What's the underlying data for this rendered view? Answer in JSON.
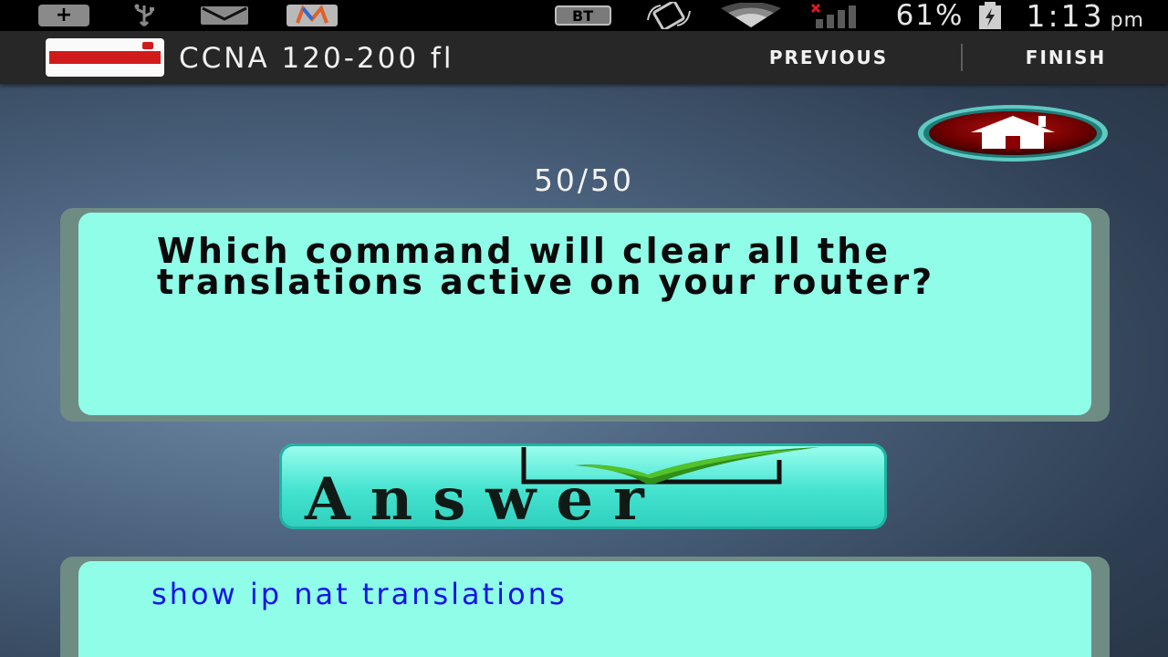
{
  "status_bar": {
    "icons_left": [
      "plus-icon",
      "usb-icon",
      "gmail-icon",
      "m-app-icon"
    ],
    "bt_label": "BT",
    "battery_percent": "61%",
    "time": "1:13",
    "time_suffix": "pm"
  },
  "action_bar": {
    "title": "CCNA 120-200 fl",
    "previous_label": "PREVIOUS",
    "finish_label": "FINISH"
  },
  "quiz": {
    "counter": "50/50",
    "question": "Which command will clear all the translations active on your router?",
    "answer_button_label": "Answer",
    "answer_text": "show ip nat translations"
  },
  "colors": {
    "card": "#8ffde8",
    "answer_text": "#1414e8",
    "home_button": "#8b0000",
    "accent": "#44e3cf"
  }
}
